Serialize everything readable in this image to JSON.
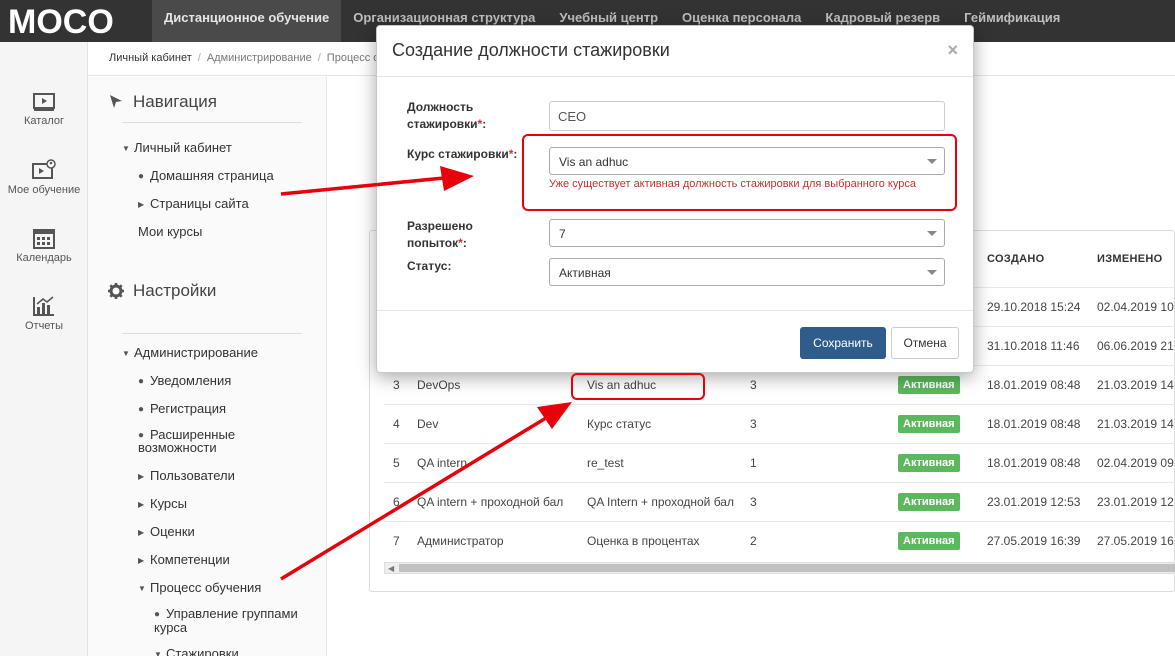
{
  "topnav": {
    "logo_text": "MOCO",
    "tabs": [
      {
        "label": "Дистанционное обучение",
        "active": true
      },
      {
        "label": "Организационная структура"
      },
      {
        "label": "Учебный центр"
      },
      {
        "label": "Оценка персонала"
      },
      {
        "label": "Кадровый резерв"
      },
      {
        "label": "Геймификация"
      }
    ]
  },
  "rail": {
    "items": [
      {
        "label": "Каталог",
        "icon": "play-icon"
      },
      {
        "label": "Мое обучение",
        "icon": "my-learning-icon"
      },
      {
        "label": "Календарь",
        "icon": "calendar-icon"
      },
      {
        "label": "Отчеты",
        "icon": "chart-icon"
      }
    ]
  },
  "breadcrumb": [
    "Личный кабинет",
    "Администрирование",
    "Процесс о"
  ],
  "sidebar": {
    "nav_title": "Навигация",
    "nav_items": [
      "Личный кабинет",
      "Домашняя страница",
      "Страницы сайта",
      "Мои курсы"
    ],
    "settings_title": "Настройки",
    "settings_items": [
      "Администрирование",
      "Уведомления",
      "Регистрация",
      "Расширенные",
      "возможности",
      "Пользователи",
      "Курсы",
      "Оценки",
      "Компетенции",
      "Процесс обучения",
      "Управление группами",
      "курса",
      "Стажировки"
    ]
  },
  "table": {
    "columns": {
      "created": "СОЗДАНО",
      "changed": "ИЗМЕНЕНО"
    },
    "rows": [
      {
        "created": "29.10.2018 15:24",
        "changed": "02.04.2019 10"
      },
      {
        "created": "31.10.2018 11:46",
        "changed": "06.06.2019 21"
      },
      {
        "num": "3",
        "name": "DevOps",
        "course": "Vis an adhuc",
        "attempts": "3",
        "status": "Активная",
        "created": "18.01.2019 08:48",
        "changed": "21.03.2019 14"
      },
      {
        "num": "4",
        "name": "Dev",
        "course": "Курс статус",
        "attempts": "3",
        "status": "Активная",
        "created": "18.01.2019 08:48",
        "changed": "21.03.2019 14"
      },
      {
        "num": "5",
        "name": "QA intern",
        "course": "re_test",
        "attempts": "1",
        "status": "Активная",
        "created": "18.01.2019 08:48",
        "changed": "02.04.2019 09"
      },
      {
        "num": "6",
        "name": "QA intern + проходной бал",
        "course": "QA Intern + проходной бал",
        "attempts": "3",
        "status": "Активная",
        "created": "23.01.2019 12:53",
        "changed": "23.01.2019 12"
      },
      {
        "num": "7",
        "name": "Администратор",
        "course": "Оценка в процентах",
        "attempts": "2",
        "status": "Активная",
        "created": "27.05.2019 16:39",
        "changed": "27.05.2019 16"
      }
    ]
  },
  "modal": {
    "title": "Создание должности стажировки",
    "close": "×",
    "position_label_1": "Должность",
    "position_label_2": "стажировки",
    "position_value": "CEO",
    "course_label": "Курс стажировки",
    "course_value": "Vis an adhuc",
    "error_text": "Уже существует активная должность стажировки для выбранного курса",
    "attempts_label_1": "Разрешено",
    "attempts_label_2": "попыток",
    "attempts_value": "7",
    "status_label": "Статус:",
    "status_value": "Активная",
    "required_mark": "*",
    "colon": ":",
    "save": "Сохранить",
    "cancel": "Отмена"
  },
  "colors": {
    "accent": "#2e5d8c",
    "active_badge": "#5cb85c",
    "error": "#c9302c",
    "annotation": "#e8000b",
    "topbar": "#333333"
  }
}
